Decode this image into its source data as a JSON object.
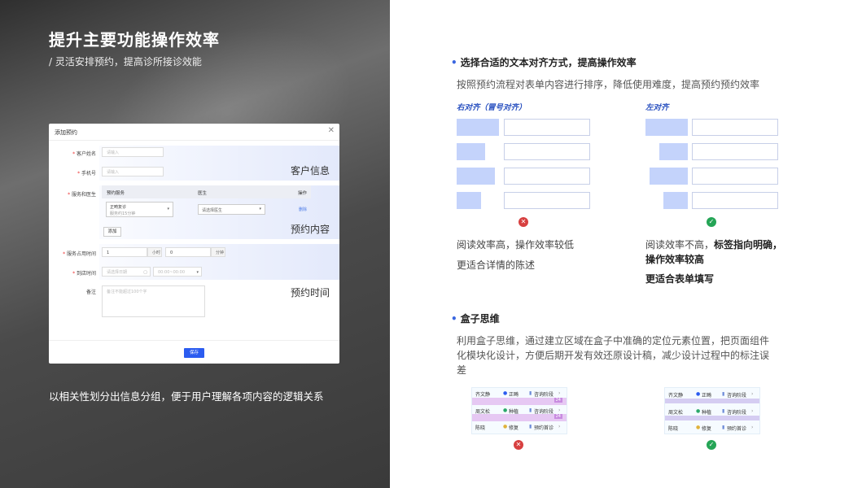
{
  "left": {
    "title": "提升主要功能操作效率",
    "subtitle": "/ 灵活安排预约，提高诊所接诊效能",
    "caption": "以相关性划分出信息分组，便于用户理解各项内容的逻辑关系",
    "dialog": {
      "title": "添加预约",
      "close": "✕",
      "fields": {
        "customer_name_label": "客户姓名",
        "customer_name_placeholder": "请输入",
        "phone_label": "手机号",
        "phone_placeholder": "请输入",
        "service_doctor_label": "服务和医生",
        "duration_label": "服务占用时间",
        "arrival_label": "到店时间",
        "notes_label": "备注",
        "notes_placeholder": "备注不能超过100个字"
      },
      "table": {
        "headers": [
          "预约服务",
          "医生",
          "操作"
        ],
        "service_value": "正畸复诊",
        "service_hint": "服务约15分钟",
        "doctor_placeholder": "请选择医生",
        "delete": "删除",
        "add": "添加"
      },
      "duration": {
        "hours": "1",
        "hours_unit": "小时",
        "minutes": "0",
        "minutes_unit": "分钟"
      },
      "arrival": {
        "date_placeholder": "请选择日期",
        "time_placeholder": "00:00~00:00"
      },
      "group_tags": [
        "客户信息",
        "预约内容",
        "预约时间"
      ],
      "save": "保存"
    }
  },
  "right": {
    "section1": {
      "title": "选择合适的文本对齐方式，提高操作效率",
      "desc": "按照预约流程对表单内容进行排序，降低使用难度，提高预约预约效率",
      "right_align_label": "右对齐（冒号对齐）",
      "left_align_label": "左对齐",
      "bad_line1": "阅读效率高，操作效率较低",
      "bad_line2": "更适合详情的陈述",
      "good_line1_plain": "阅读效率不高，",
      "good_line1_bold": "标签指向明确，",
      "good_line2": "操作效率较高",
      "good_line3": "更适合表单填写"
    },
    "section2": {
      "title": "盒子思维",
      "desc_line1": "利用盒子思维，通过建立区域在盒子中准确的定位元素位置，把页面组件",
      "desc_line2": "化模块化设计，方便后期开发有效还原设计稿，减少设计过程中的标注误",
      "desc_line3": "差",
      "rows": [
        {
          "name": "齐文静",
          "type": "正畸",
          "stage": "咨询阶段"
        },
        {
          "name": "周文松",
          "type": "种植",
          "stage": "咨询阶段"
        },
        {
          "name": "陈晓",
          "type": "修复",
          "stage": "预约首诊"
        }
      ],
      "badge": "24"
    }
  },
  "icons": {
    "bad": "x-circle-icon",
    "good": "check-circle-icon",
    "bullet": "dot-icon"
  },
  "colors": {
    "accent": "#2b5cf0",
    "bad": "#d74040",
    "good": "#25a556"
  }
}
